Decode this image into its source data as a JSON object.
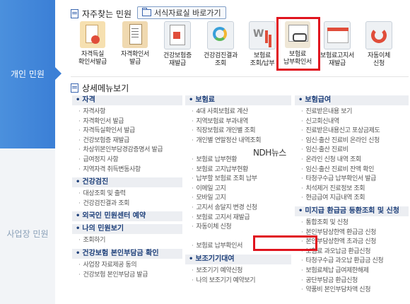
{
  "sidebar": {
    "items": [
      {
        "label": "개인 민원"
      },
      {
        "label": "사업장 민원"
      }
    ]
  },
  "frequent": {
    "title": "자주찾는 민원",
    "shortcut_label": "서식자료실 바로가기",
    "tiles": [
      {
        "label": "자격득실\n확인서발급",
        "icon": "certificate-icon"
      },
      {
        "label": "자격확인서\n발급",
        "icon": "document-icon"
      },
      {
        "label": "건강보험증\n재발급",
        "icon": "insurance-card-icon"
      },
      {
        "label": "건강검진결과\n조회",
        "icon": "pie-chart-icon"
      },
      {
        "label": "보험료\n조회/납부",
        "icon": "bar-chart-icon"
      },
      {
        "label": "보험료\n납부확인서",
        "icon": "receipt-glasses-icon"
      },
      {
        "label": "보험료고지서\n재발급",
        "icon": "bill-icon"
      },
      {
        "label": "자동이체\n신청",
        "icon": "refresh-icon"
      }
    ]
  },
  "detail": {
    "title": "상세메뉴보기",
    "col1": [
      {
        "title": "자격",
        "items": [
          "자격사항",
          "자격확인서 발급",
          "자격득실확인서 발급",
          "건강보험증 재발급",
          "차상위본인부담경감증명서 발급",
          "급여정지 사항",
          "지역자격 취득변동사항"
        ]
      },
      {
        "title": "건강검진",
        "items": [
          "대상조회 및 출력",
          "건강검진결과 조회"
        ]
      },
      {
        "title": "외국인 민원센터 예약",
        "items": []
      },
      {
        "title": "나의 민원보기",
        "items": [
          "조회하기"
        ]
      },
      {
        "title": "건강보험 본인부담금 확인",
        "items": [
          "사업장 자료제공 동의",
          "건강보험 본인부담금 발급"
        ]
      }
    ],
    "col2": [
      {
        "title": "보험료",
        "items": [
          "4대 사회보험료 계산",
          "지역보험료 부과내역",
          "직장보험료 개인별 조회",
          "개인별 연말정산 내역조회",
          "",
          "보험료 납부현황",
          "보험료 고지납부현황",
          "납부할 보험료 조회 납부",
          "이메일 고지",
          "모바일 고지",
          "고지서 송달지 변경 신청",
          "보험료 고지서 재발급",
          "자동이체 신청",
          "",
          "보험료 납부확인서"
        ]
      },
      {
        "title": "보조기기대여",
        "items": [
          "보조기기 예약신청",
          "나의 보조기기 예약보기"
        ]
      }
    ],
    "col3": [
      {
        "title": "보험급여",
        "items": [
          "진료받은내용 보기",
          "신고회신내역",
          "진료받은내용신고 포상금제도",
          "임신·출산 진료비 온라인 신청",
          "임신·출산 진료비",
          "온라인 신청 내역 조회",
          "임신·출산 진료비 잔액 확인",
          "타청구수급 납부확인서 발급",
          "치석제거 진료정보 조회",
          "현금급여 지급내역 조회"
        ]
      },
      {
        "title": "미지급 환급금 등환조회 및 신청",
        "items": [
          "통합조회 및 신청",
          "본인부담상한액 환급금 신청",
          "본인부담상한액 초과금 신청",
          "보험료 과오납금 환급신청",
          "타청구수급 과오납 환급금 신청",
          "보험료체납 급여제한해제",
          "공단부담금 환급신청",
          "약품비 본인부담차액 신청"
        ]
      }
    ]
  },
  "watermark": "NDH뉴스",
  "colors": {
    "sidebar_active": "#3b7fd6",
    "highlight": "#e0141e",
    "category_text": "#1d3f7a"
  }
}
